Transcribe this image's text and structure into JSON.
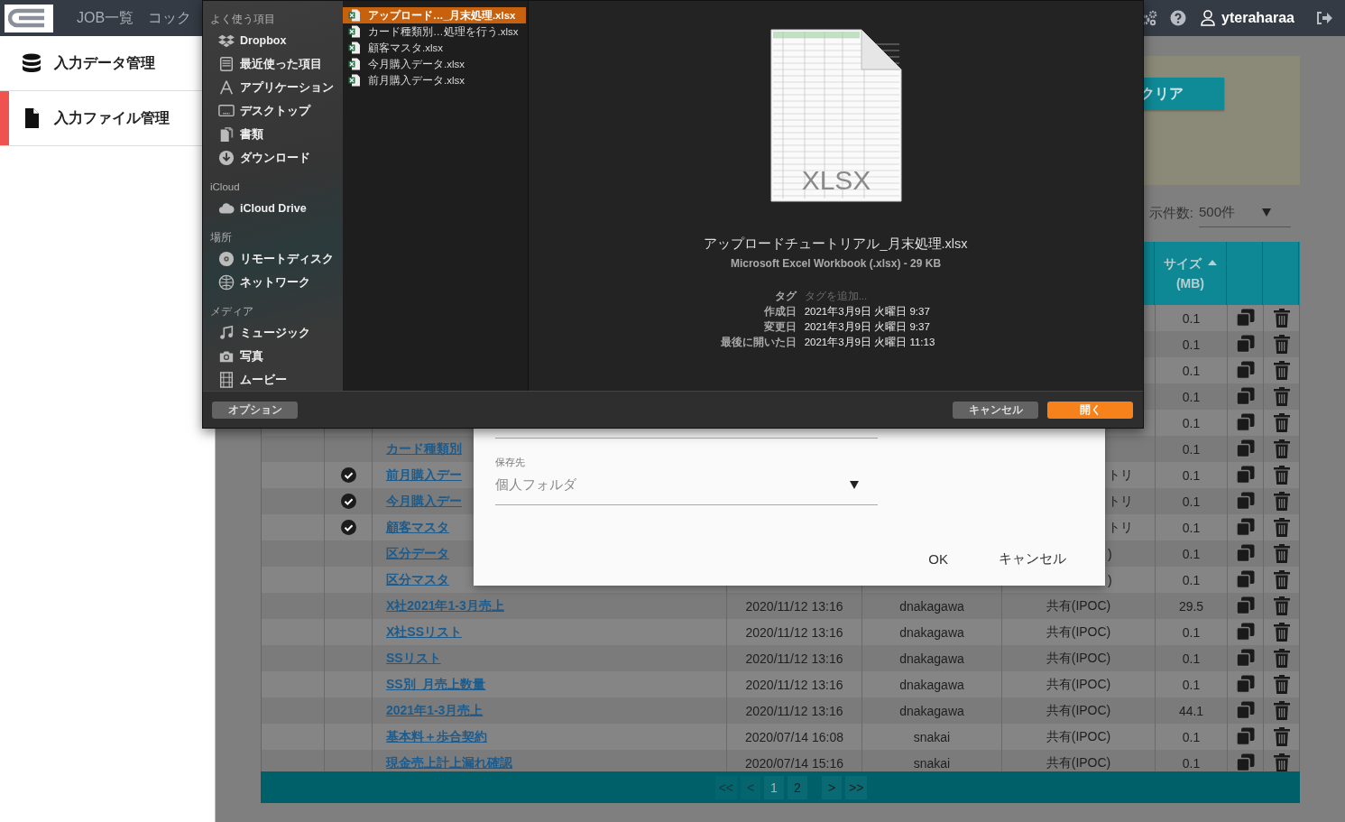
{
  "header": {
    "nav": [
      "JOB一覧",
      "コック"
    ],
    "user": "yteraharaa"
  },
  "sidebar": {
    "items": [
      {
        "label": "入力データ管理",
        "selected": false
      },
      {
        "label": "入力ファイル管理",
        "selected": true
      }
    ]
  },
  "filter_panel": {
    "button": "クリア"
  },
  "page_size": {
    "label": "示件数:",
    "value": "500件"
  },
  "table": {
    "size_column": {
      "label": "サイズ",
      "unit": "(MB)"
    },
    "rows": [
      {
        "size": "0.1"
      },
      {
        "size": "0.1"
      },
      {
        "size": "0.1"
      },
      {
        "size": "0.1"
      },
      {
        "size": "0.1"
      },
      {
        "checked": false,
        "name": "カード種類別",
        "size": "0.1"
      },
      {
        "checked": true,
        "name": "前月購入デー",
        "share": "トリ",
        "size": "0.1"
      },
      {
        "checked": true,
        "name": "今月購入デー",
        "share": "トリ",
        "size": "0.1"
      },
      {
        "checked": true,
        "name": "顧客マスタ",
        "share": "トリ",
        "size": "0.1"
      },
      {
        "checked": false,
        "name": "区分データ",
        "share": ")",
        "size": "0.1"
      },
      {
        "checked": false,
        "name": "区分マスタ",
        "share": ")",
        "size": "0.1"
      },
      {
        "checked": false,
        "name": "X社2021年1-3月売上",
        "date": "2020/11/12 13:16",
        "user": "dnakagawa",
        "share": "共有(IPOC)",
        "size": "29.5"
      },
      {
        "checked": false,
        "name": "X社SSリスト",
        "date": "2020/11/12 13:16",
        "user": "dnakagawa",
        "share": "共有(IPOC)",
        "size": "0.1"
      },
      {
        "checked": false,
        "name": "SSリスト",
        "date": "2020/11/12 13:16",
        "user": "dnakagawa",
        "share": "共有(IPOC)",
        "size": "0.1"
      },
      {
        "checked": false,
        "name": "SS別_月売上数量",
        "date": "2020/11/12 13:16",
        "user": "dnakagawa",
        "share": "共有(IPOC)",
        "size": "0.1"
      },
      {
        "checked": false,
        "name": "2021年1-3月売上",
        "date": "2020/11/12 13:16",
        "user": "dnakagawa",
        "share": "共有(IPOC)",
        "size": "44.1"
      },
      {
        "checked": false,
        "name": "基本料＋歩合契約",
        "date": "2020/07/14 16:08",
        "user": "snakai",
        "share": "共有(IPOC)",
        "size": "0.1"
      },
      {
        "checked": false,
        "name": "現金売上計上漏れ確認",
        "date": "2020/07/14 15:16",
        "user": "snakai",
        "share": "共有(IPOC)",
        "size": "0.1"
      }
    ]
  },
  "pagination": {
    "buttons": [
      {
        "label": "<<",
        "disabled": true,
        "selected": false
      },
      {
        "label": "<",
        "disabled": true,
        "selected": false
      },
      {
        "label": "1",
        "disabled": false,
        "selected": true
      },
      {
        "label": "2",
        "disabled": false,
        "selected": false
      },
      {
        "label": ">",
        "disabled": false,
        "selected": false
      },
      {
        "label": ">>",
        "disabled": false,
        "selected": false
      }
    ]
  },
  "save_modal": {
    "field_label": "保存先",
    "select_value": "個人フォルダ",
    "buttons": [
      "OK",
      "キャンセル"
    ]
  },
  "file_dialog": {
    "sidebar": [
      {
        "heading": "よく使う項目",
        "items": [
          {
            "label": "Dropbox"
          },
          {
            "label": "最近使った項目"
          },
          {
            "label": "アプリケーション"
          },
          {
            "label": "デスクトップ"
          },
          {
            "label": "書類"
          },
          {
            "label": "ダウンロード"
          }
        ]
      },
      {
        "heading": "iCloud",
        "items": [
          {
            "label": "iCloud Drive"
          }
        ]
      },
      {
        "heading": "場所",
        "items": [
          {
            "label": "リモートディスク"
          },
          {
            "label": "ネットワーク"
          }
        ]
      },
      {
        "heading": "メディア",
        "items": [
          {
            "label": "ミュージック"
          },
          {
            "label": "写真"
          },
          {
            "label": "ムービー"
          }
        ]
      }
    ],
    "files": [
      {
        "name": "アップロード…_月末処理.xlsx",
        "selected": true
      },
      {
        "name": "カード種類別…処理を行う.xlsx",
        "selected": false
      },
      {
        "name": "顧客マスタ.xlsx",
        "selected": false
      },
      {
        "name": "今月購入データ.xlsx",
        "selected": false
      },
      {
        "name": "前月購入データ.xlsx",
        "selected": false
      }
    ],
    "preview": {
      "thumbnail_label": "XLSX",
      "filename": "アップロードチュートリアル_月末処理.xlsx",
      "type": "Microsoft Excel Workbook (.xlsx) - 29 KB",
      "info": [
        {
          "label": "タグ",
          "placeholder": "タグを追加..."
        },
        {
          "label": "作成日",
          "value": "2021年3月9日 火曜日 9:37"
        },
        {
          "label": "変更日",
          "value": "2021年3月9日 火曜日 9:37"
        },
        {
          "label": "最後に開いた日",
          "value": "2021年3月9日 火曜日 11:13"
        }
      ]
    },
    "buttons": [
      {
        "label": "オプション",
        "kind": "secondary"
      },
      {
        "label": "キャンセル",
        "kind": "secondary"
      },
      {
        "label": "開く",
        "kind": "primary"
      }
    ]
  }
}
